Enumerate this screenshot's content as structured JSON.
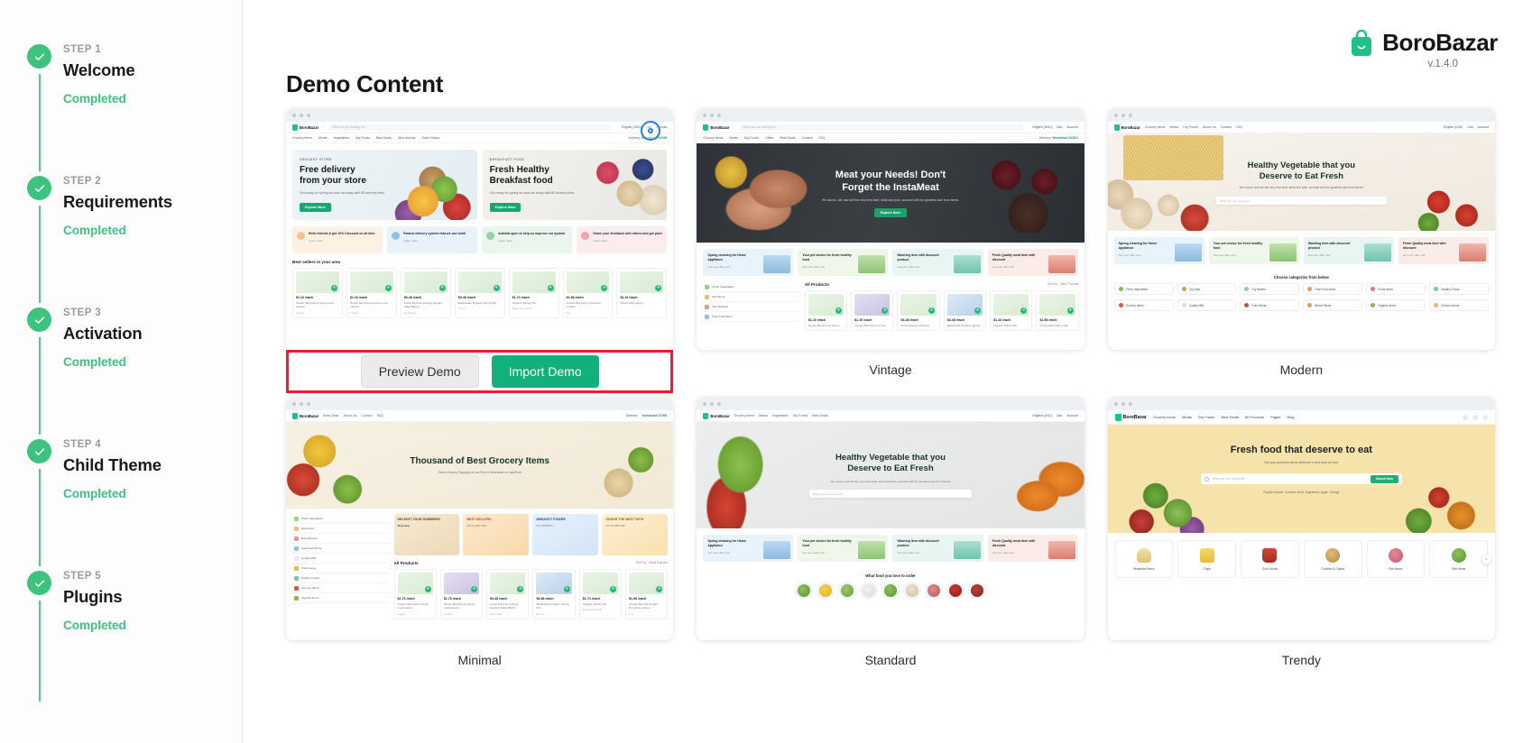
{
  "sidebar": {
    "steps": [
      {
        "num": "STEP 1",
        "title": "Welcome",
        "status": "Completed"
      },
      {
        "num": "STEP 2",
        "title": "Requirements",
        "status": "Completed"
      },
      {
        "num": "STEP 3",
        "title": "Activation",
        "status": "Completed"
      },
      {
        "num": "STEP 4",
        "title": "Child Theme",
        "status": "Completed"
      },
      {
        "num": "STEP 5",
        "title": "Plugins",
        "status": "Completed"
      }
    ]
  },
  "brand": {
    "name": "BoroBazar",
    "version": "v.1.4.0",
    "icon": "shopping-bag-icon"
  },
  "page": {
    "title": "Demo Content"
  },
  "actions": {
    "preview_label": "Preview Demo",
    "import_label": "Import Demo"
  },
  "colors": {
    "green": "#3ec37f",
    "brand_green": "#20c187",
    "import_button": "#13b07c",
    "highlight_border": "#f5192b",
    "focus_ring": "#2a7fe0",
    "trendy_hero": "#f6e3ab"
  },
  "demos": [
    {
      "caption": "",
      "nav": {
        "logo": "BoroBazar",
        "search_placeholder": "What are you looking for...",
        "links": [
          "Grocery Items",
          "Meats",
          "Vegetables",
          "Dry Foods",
          "Best Deals",
          "New Arrivals",
          "Order Status"
        ],
        "right": [
          "English (USD)",
          "Cart",
          "Account"
        ],
        "delivery_label": "Delivery:",
        "delivery_value": "Mohakhali DOHS"
      },
      "heroes": [
        {
          "kicker": "GROCERY STORE",
          "title": "Free delivery\nfrom your store",
          "desc": "Get ready for spring as soon as today with $0 delivery fees.",
          "button": "Explore More"
        },
        {
          "kicker": "BREAKFAST FOOD",
          "title": "Fresh Healthy\nBreakfast food",
          "desc": "Get ready for spring as soon as today with $0 delivery fees.",
          "button": "Explore More"
        }
      ],
      "promos": [
        {
          "title": "Refer friends & get 10% Discount on all item",
          "sub": "Learn more"
        },
        {
          "title": "Fastest delivery system that we can build",
          "sub": "Learn more"
        },
        {
          "title": "Admiral open to help us improve our system",
          "sub": "Learn more"
        },
        {
          "title": "Share your feedback with others and get prize",
          "sub": "Learn more"
        }
      ],
      "section_title": "Best sellers in your area",
      "section_link": "",
      "products": [
        {
          "price": "$1.16 /each",
          "old": "",
          "name": "Ocean Mist Farms Green Leaf Lettuce",
          "unit": "1 each"
        },
        {
          "price": "$1.16 /each",
          "old": "",
          "name": "Ocean Mist Farms Green Leaf Lettuce",
          "unit": "1 each"
        },
        {
          "price": "$3.48 /each",
          "old": "$3.99",
          "name": "Fresh Express Iceberg Garden Salad Blend",
          "unit": "12 oz bag"
        },
        {
          "price": "$3.48 /each",
          "old": "",
          "name": "Marketside Organic Spring Mix",
          "unit": "5.5 oz"
        },
        {
          "price": "$1.74 /each",
          "old": "$1.99",
          "name": "Organic Spring Mix",
          "unit": "About per pound"
        },
        {
          "price": "$1.98 /each",
          "old": "",
          "name": "Ocean Mist Farms Romaine Lettuce",
          "unit": "1 ct"
        },
        {
          "price": "$1.16 /each",
          "old": "",
          "name": "Ocean Mist Farms",
          "unit": ""
        }
      ]
    },
    {
      "caption": "Vintage",
      "nav": {
        "logo": "BoroBazar",
        "search_placeholder": "What are you looking for...",
        "links": [
          "Grocery Items",
          "Meats",
          "Dry Foods",
          "Offers",
          "Best Deals",
          "Contact",
          "FAQ"
        ],
        "right": [
          "English (USD)",
          "Cart",
          "Account"
        ],
        "delivery_label": "Delivery:",
        "delivery_value": "Mohakhali DOHS"
      },
      "hero": {
        "title": "Meat your Needs! Don't\nForget the InstaMeat",
        "desc": "We source, kill, and sell the very best beef, lamb and pork, sourced with the greatest care from farms.",
        "button": "Explore More"
      },
      "categories": [
        {
          "title": "Spring cleaning for Home Appliance",
          "sub": "Get your offer now"
        },
        {
          "title": "Your pet choice for fresh healthy food",
          "sub": "Get your offer now"
        },
        {
          "title": "Washing item with discount product",
          "sub": "Get your offer now"
        },
        {
          "title": "Fresh Quality meat item with discount",
          "sub": "Get your offer now"
        }
      ],
      "sidebar_items": [
        "Fresh Vegetables",
        "Diet Items",
        "Diet Nutrition",
        "Fast Food Items"
      ],
      "section_title": "All Products",
      "section_link": "Sort by : New Popular",
      "products": [
        {
          "price": "$1.16 /each",
          "old": "",
          "name": "Ocean Mist Farms Green",
          "unit": ""
        },
        {
          "price": "$1.16 /each",
          "old": "",
          "name": "Ocean Mist Farms Green",
          "unit": ""
        },
        {
          "price": "$3.48 /each",
          "old": "",
          "name": "Fresh Express Iceberg",
          "unit": ""
        },
        {
          "price": "$3.48 /each",
          "old": "",
          "name": "Marketside Organic Spring",
          "unit": ""
        },
        {
          "price": "$1.16 /each",
          "old": "",
          "name": "Organic Spring Mix",
          "unit": ""
        },
        {
          "price": "$1.98 /each",
          "old": "",
          "name": "Ocean Mist Farms with",
          "unit": ""
        }
      ]
    },
    {
      "caption": "Modern",
      "nav": {
        "logo": "BoroBazar",
        "links": [
          "Grocery Items",
          "Meats",
          "Dry Foods",
          "About Us",
          "Contact",
          "FAQ"
        ],
        "right": [
          "English (USD)",
          "Cart",
          "Account"
        ]
      },
      "hero": {
        "title": "Healthy Vegetable that you\nDeserve to Eat Fresh",
        "desc": "We source and sell the very best beef, lamb and pork, sourced with the greatest care from farmer",
        "search_placeholder": "What are you looking for..."
      },
      "categories": [
        {
          "title": "Spring cleaning for Home Appliance",
          "sub": "Get your offer now"
        },
        {
          "title": "Your pet choice for fresh healthy food",
          "sub": "Get your offer now"
        },
        {
          "title": "Washing item with discount product",
          "sub": "Get your offer now"
        },
        {
          "title": "Fresh Quality meat item with discount",
          "sub": "Get your offer now"
        }
      ],
      "chips_title": "Choose categories from below",
      "chips": [
        [
          "Fresh Vegetables",
          "Dry Nuts",
          "Dry Bottles",
          "Fast Food Items",
          "Fruits Items",
          "Healthy Foods"
        ],
        [
          "Grocery Items",
          "Quality Milk",
          "Cold Drinks",
          "Bread Slices",
          "Organic Items",
          "Chicken Items"
        ]
      ]
    },
    {
      "caption": "Minimal",
      "nav": {
        "logo": "BoroBazar",
        "links": [
          "Best Deals",
          "About Us",
          "Contact",
          "FAQ"
        ],
        "delivery_label": "Delivery:",
        "delivery_value": "Mohakhali DOHS",
        "right": [
          "Cart",
          "Account"
        ]
      },
      "hero": {
        "title": "Thousand of Best Grocery Items",
        "desc": "Online Grocery Shopping at Low Price in Worldwide on InstaFood"
      },
      "sidebar_items": [
        "Fresh Vegetables",
        "Diet Items",
        "Diet Nutrition",
        "Fast Food Items",
        "Quality Milk",
        "Fruits Items",
        "Healthy Foods",
        "Grocery Items",
        "Organic Items"
      ],
      "banners": [
        {
          "title": "DELIGHT YOUR SUMMERS!",
          "sub": "Shop Now"
        },
        {
          "title": "BEST SELLERS",
          "sub": "UP TO 20% OFF"
        },
        {
          "title": "IMMUNITY POWER",
          "sub": "OF VITAMIN C"
        },
        {
          "title": "ORDER THE BEST WITH",
          "sub": "UP TO 25% OFF"
        }
      ],
      "section_title": "All Products",
      "section_link": "Sort by : Most Popular",
      "products": [
        {
          "price": "$1.76 /each",
          "old": "",
          "name": "Ocean Mist Farms Green Leaf Lettuce",
          "unit": "1 each"
        },
        {
          "price": "$1.76 /each",
          "old": "",
          "name": "Ocean Mist Farms Green Leaf Lettuce",
          "unit": "1 each"
        },
        {
          "price": "$3.48 /each",
          "old": "",
          "name": "Fresh Express Iceberg Garden Salad Blend",
          "unit": "12 oz bag"
        },
        {
          "price": "$3.48 /each",
          "old": "",
          "name": "Marketside Organic Spring Mix",
          "unit": "5.5 oz"
        },
        {
          "price": "$1.74 /each",
          "old": "",
          "name": "Organic Spring Mix",
          "unit": "About per pound"
        },
        {
          "price": "$1.98 /each",
          "old": "",
          "name": "Ocean Mist Farms with Romaine Lettuce",
          "unit": "1 ct"
        }
      ]
    },
    {
      "caption": "Standard",
      "nav": {
        "logo": "BoroBazar",
        "links": [
          "Grocery Items",
          "Meats",
          "Vegetables",
          "Dry Foods",
          "Best Deals"
        ],
        "right": [
          "English (USD)",
          "Cart",
          "Account"
        ]
      },
      "hero": {
        "title": "Healthy Vegetable that you\nDeserve to Eat Fresh",
        "desc": "We source and sell the very best beef, lamb and pork, sourced with the greatest care from farmer",
        "search_placeholder": "What are you looking for..."
      },
      "categories": [
        {
          "title": "Spring cleaning for Home Appliance",
          "sub": "Get your offer now"
        },
        {
          "title": "Your pet choice for fresh healthy food",
          "sub": "Get your offer now"
        },
        {
          "title": "Washing item with discount product",
          "sub": "Get your offer now"
        },
        {
          "title": "Fresh Quality meat item with discount",
          "sub": "Get your offer now"
        }
      ],
      "foot_title": "What food you love to order"
    },
    {
      "caption": "Trendy",
      "nav": {
        "logo": "BoroBazar",
        "links": [
          "Grocery Items",
          "Meats",
          "Dry Foods",
          "Best Deals",
          "All Products",
          "Pages",
          "Blog"
        ]
      },
      "hero": {
        "title": "Fresh food that deserve to eat",
        "desc": "Get your groceries items delivered in less than an hour",
        "search_placeholder": "What are you looking for...",
        "search_button": "Search Now",
        "popular": "Popular Search: Coconut, Meat, Vegetables, Apple, Orange"
      },
      "categories": [
        "Breakfast Items",
        "Chips",
        "Cold Drinks",
        "Cookies & Cakes",
        "Deli Items",
        "Diet Items"
      ]
    }
  ]
}
